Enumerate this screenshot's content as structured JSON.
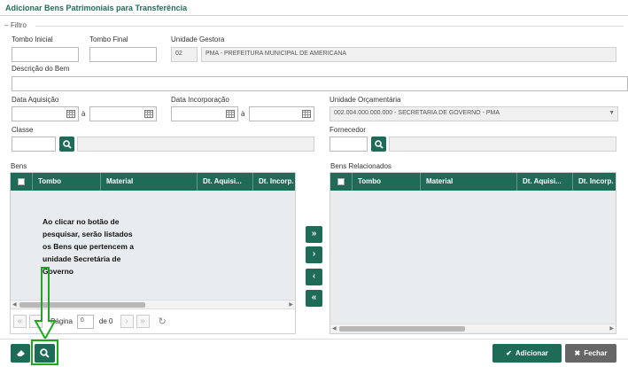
{
  "page_title": "Adicionar Bens Patrimoniais para Transferência",
  "filter": {
    "legend": "Filtro",
    "tombo_inicial_label": "Tombo Inicial",
    "tombo_final_label": "Tombo Final",
    "unidade_gestora_label": "Unidade Gestora",
    "unidade_gestora_code": "02",
    "unidade_gestora_name": "PMA - PREFEITURA MUNICIPAL DE AMERICANA",
    "descricao_label": "Descrição do Bem",
    "data_aquisicao_label": "Data Aquisição",
    "data_incorporacao_label": "Data Incorporação",
    "range_sep": "à",
    "unidade_orcamentaria_label": "Unidade Orçamentária",
    "unidade_orcamentaria_value": "002.004.000.000.000 - SECRETARIA DE GOVERNO - PMA",
    "classe_label": "Classe",
    "fornecedor_label": "Fornecedor"
  },
  "bens": {
    "title": "Bens",
    "columns": [
      "Tombo",
      "Material",
      "Dt. Aquisi...",
      "Dt. Incorp."
    ],
    "pager": {
      "page_label": "Página",
      "page_value": "0",
      "of_label": "de 0"
    }
  },
  "bens_relacionados": {
    "title": "Bens Relacionados",
    "columns": [
      "Tombo",
      "Material",
      "Dt. Aquisi...",
      "Dt. Incorp."
    ]
  },
  "annotation": "Ao clicar no botão de pesquisar, serão listados os Bens que pertencem a unidade Secretária de Governo",
  "transfer_buttons": [
    "»",
    "›",
    "‹",
    "«"
  ],
  "footer": {
    "add_label": "Adicionar",
    "close_label": "Fechar"
  },
  "colors": {
    "primary": "#1e6b57",
    "highlight": "#1fa81f",
    "close": "#666666"
  }
}
